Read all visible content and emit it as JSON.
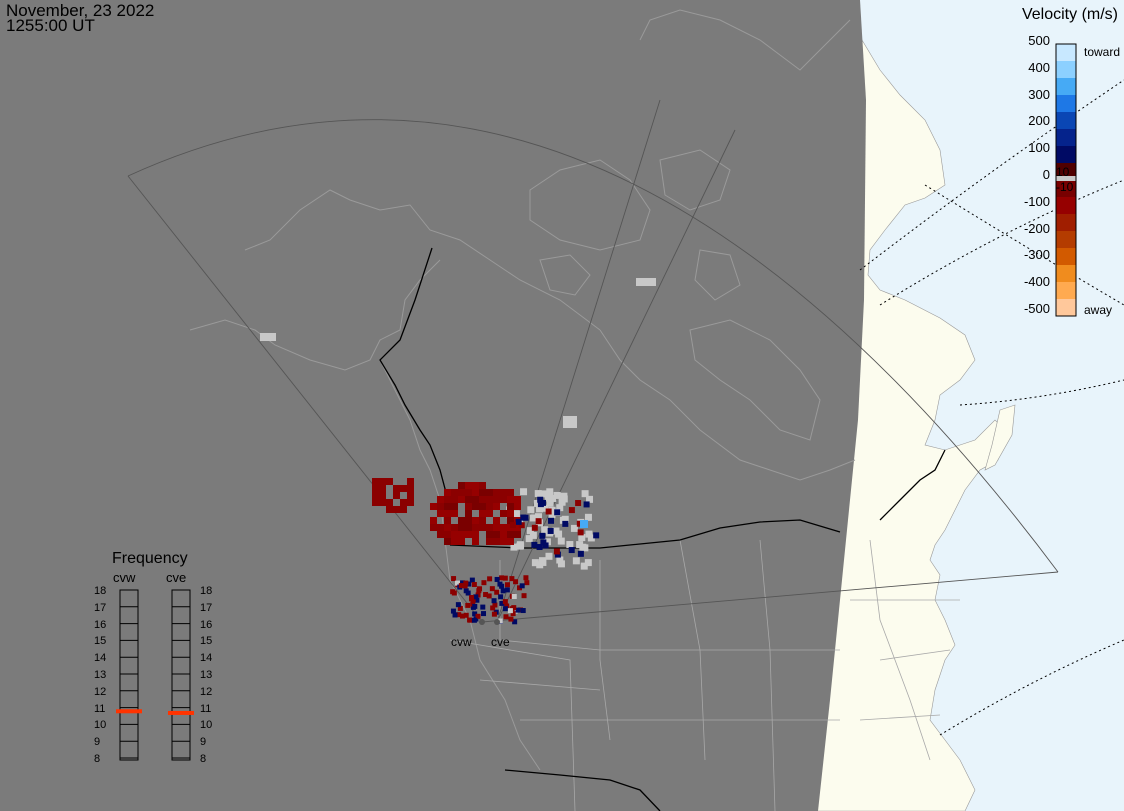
{
  "header": {
    "date": "November, 23 2022",
    "time": "1255:00 UT"
  },
  "velocity_scale": {
    "title": "Velocity (m/s)",
    "ticks": [
      "500",
      "400",
      "300",
      "200",
      "100",
      "0",
      "-100",
      "-200",
      "-300",
      "-400",
      "-500"
    ],
    "toward_label": "toward",
    "away_label": "away",
    "threshold_high": "10",
    "threshold_low": "-10",
    "colors": [
      "#c8e8ff",
      "#8cd0ff",
      "#46aaf5",
      "#1e78e6",
      "#0a46b4",
      "#05238c",
      "#000a64",
      "#500000",
      "#780000",
      "#960000",
      "#a01e00",
      "#b43c00",
      "#d25a00",
      "#f08c1e",
      "#ffaa50",
      "#ffc89b"
    ]
  },
  "frequency": {
    "title": "Frequency",
    "radar_left": "cvw",
    "radar_right": "cve",
    "scale": [
      "18",
      "17",
      "16",
      "15",
      "14",
      "13",
      "12",
      "11",
      "10",
      "9",
      "8"
    ],
    "cvw_freq_mhz": 10.9,
    "cve_freq_mhz": 10.8,
    "marker_color": "#ff3300"
  },
  "radars": {
    "west_label": "cvw",
    "east_label": "cve"
  },
  "colors": {
    "night": "#7b7b7b",
    "day_ocean": "#e8f4fb",
    "day_land": "#fcfcee",
    "ground_scatter": "#c8c8c8"
  }
}
